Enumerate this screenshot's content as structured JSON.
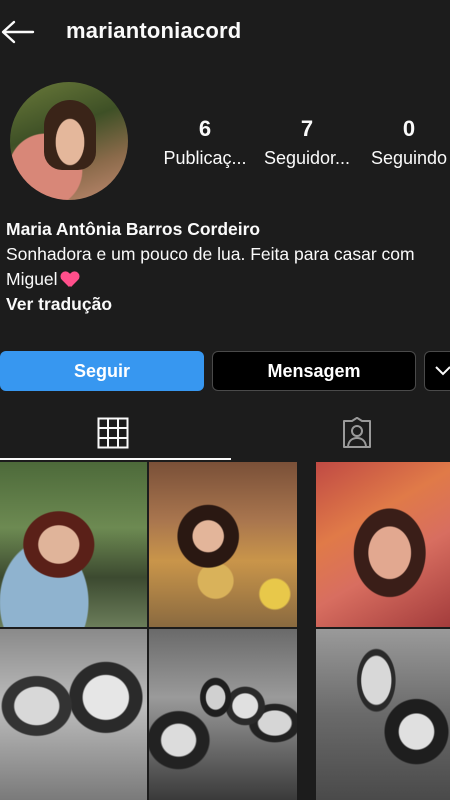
{
  "header": {
    "back_icon": "arrow-left-icon",
    "username": "mariantoniacord"
  },
  "profile": {
    "avatar": "profile-photo",
    "stats": [
      {
        "value": "6",
        "label": "Publicaç..."
      },
      {
        "value": "7",
        "label": "Seguidor..."
      },
      {
        "value": "0",
        "label": "Seguindo"
      }
    ]
  },
  "bio": {
    "full_name": "Maria Antônia Barros Cordeiro",
    "line1": "Sonhadora e um pouco de lua. Feita para casar com",
    "line2": "Miguel",
    "emoji": "heart-with-arrow-icon",
    "translate_link": "Ver tradução"
  },
  "actions": {
    "follow_label": "Seguir",
    "message_label": "Mensagem",
    "more_icon": "chevron-down-icon"
  },
  "tabs": [
    {
      "name": "posts-grid",
      "icon": "grid-icon",
      "active": true
    },
    {
      "name": "tagged",
      "icon": "tagged-person-icon",
      "active": false
    }
  ],
  "colors": {
    "background": "#1c1c1c",
    "follow_button": "#3797f0",
    "text": "#fafafa"
  },
  "posts": [
    {
      "kind": "photo",
      "tone": "color"
    },
    {
      "kind": "photo",
      "tone": "color"
    },
    {
      "kind": "photo",
      "tone": "color"
    },
    {
      "kind": "photo",
      "tone": "black-and-white"
    },
    {
      "kind": "photo",
      "tone": "black-and-white"
    },
    {
      "kind": "photo",
      "tone": "black-and-white"
    }
  ]
}
